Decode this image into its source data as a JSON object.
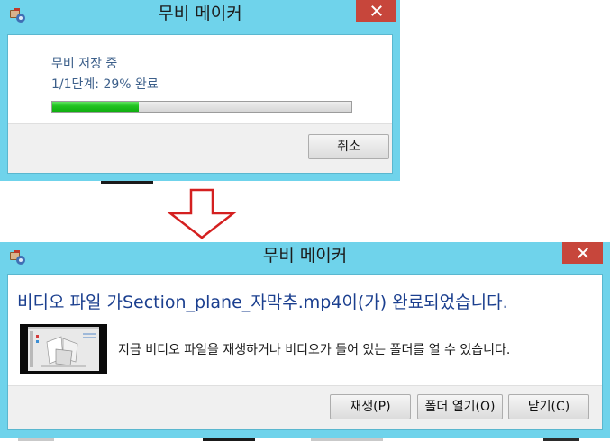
{
  "progress_dialog": {
    "title": "무비 메이커",
    "status": "무비 저장 중",
    "step": "1/1단계: 29% 완료",
    "progress": 0.29,
    "cancel_label": "취소",
    "close_icon": "close-icon"
  },
  "arrow": {
    "icon": "down-arrow-icon",
    "color": "#d42020"
  },
  "complete_dialog": {
    "title": "무비 메이커",
    "heading": "비디오 파일 가Section_plane_자막추.mp4이(가) 완료되었습니다.",
    "message": "지금 비디오 파일을 재생하거나 비디오가 들어 있는 폴더를 열 수 있습니다.",
    "play_label": "재생(P)",
    "open_folder_label": "폴더 열기(O)",
    "close_label": "닫기(C)",
    "close_icon": "close-icon",
    "thumbnail": "video-thumbnail"
  },
  "colors": {
    "title_bar": "#6fd3eb",
    "close_button": "#c7463b",
    "progress_green": "#21c221",
    "heading_blue": "#1b3f8f"
  }
}
